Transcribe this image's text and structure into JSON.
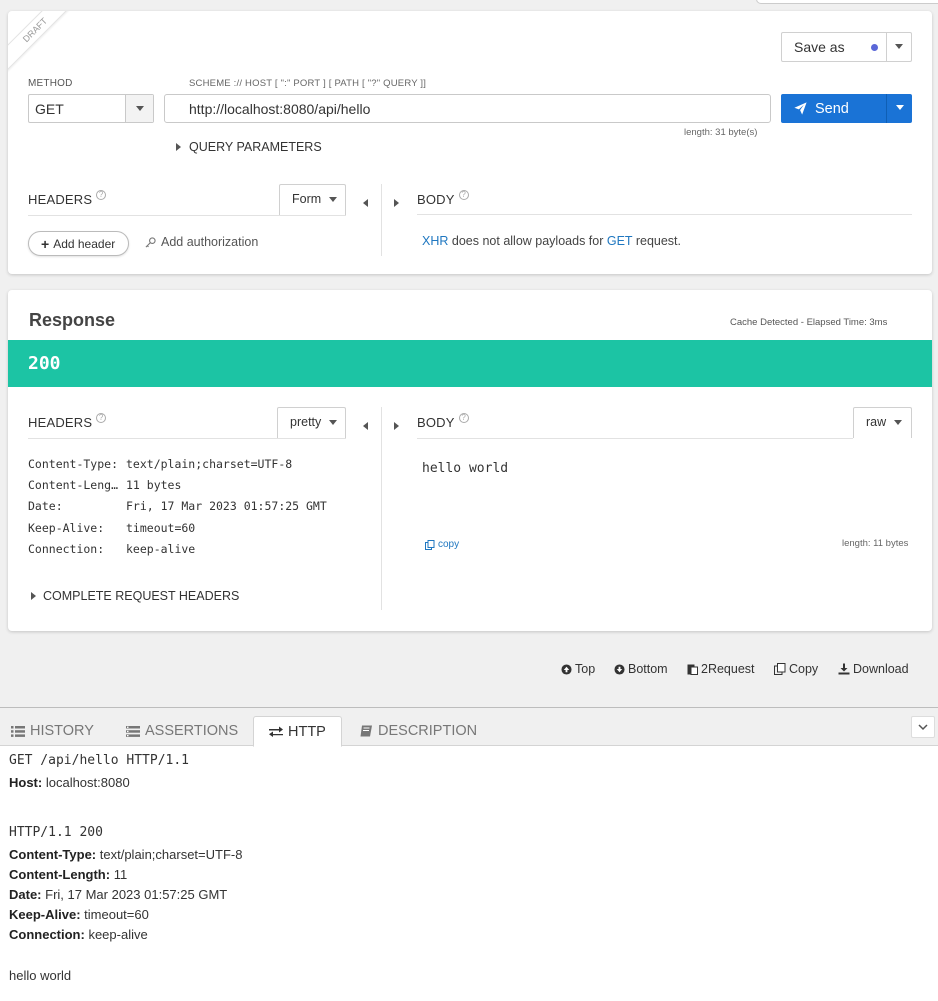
{
  "request": {
    "draft_label": "DRAFT",
    "save_as_label": "Save as",
    "method_label": "METHOD",
    "method_value": "GET",
    "url_hint": "SCHEME :// HOST [ \":\" PORT ] [ PATH [ \"?\" QUERY ]]",
    "url_value": "http://localhost:8080/api/hello",
    "url_length": "length: 31 byte(s)",
    "send_label": "Send",
    "query_params_label": "QUERY PARAMETERS",
    "headers_label": "HEADERS",
    "headers_mode": "Form",
    "add_header_label": "Add header",
    "add_auth_label": "Add authorization",
    "body_label": "BODY",
    "body_note_xhr": "XHR",
    "body_note_mid": "does not allow payloads for",
    "body_note_get": "GET",
    "body_note_end": "request."
  },
  "response": {
    "title": "Response",
    "cache_info": "Cache Detected - Elapsed Time: 3ms",
    "status_code": "200",
    "headers_label": "HEADERS",
    "headers_mode": "pretty",
    "headers": [
      {
        "key": "Content-Type:",
        "value": "text/plain;charset=UTF-8"
      },
      {
        "key": "Content-Length:",
        "value": "11 bytes"
      },
      {
        "key": "Date:",
        "value": "Fri, 17 Mar 2023 01:57:25 GMT"
      },
      {
        "key": "Keep-Alive:",
        "value": "timeout=60"
      },
      {
        "key": "Connection:",
        "value": "keep-alive"
      }
    ],
    "complete_request_headers_label": "COMPLETE REQUEST HEADERS",
    "body_label": "BODY",
    "body_mode": "raw",
    "body_text": "hello world",
    "copy_label": "copy",
    "body_length": "length: 11 bytes"
  },
  "toolbar": {
    "top_label": "Top",
    "bottom_label": "Bottom",
    "to_request_label": "2Request",
    "copy_label": "Copy",
    "download_label": "Download"
  },
  "tabs": [
    {
      "label": "HISTORY"
    },
    {
      "label": "ASSERTIONS"
    },
    {
      "label": "HTTP"
    },
    {
      "label": "DESCRIPTION"
    }
  ],
  "http": {
    "request_line": "GET /api/hello HTTP/1.1",
    "request_headers": [
      {
        "key": "Host:",
        "value": "localhost:8080"
      }
    ],
    "status_line": "HTTP/1.1 200",
    "response_headers": [
      {
        "key": "Content-Type:",
        "value": "text/plain;charset=UTF-8"
      },
      {
        "key": "Content-Length:",
        "value": "11"
      },
      {
        "key": "Date:",
        "value": "Fri, 17 Mar 2023 01:57:25 GMT"
      },
      {
        "key": "Keep-Alive:",
        "value": "timeout=60"
      },
      {
        "key": "Connection:",
        "value": "keep-alive"
      }
    ],
    "body": "hello world"
  },
  "colors": {
    "send_blue": "#1a73d6",
    "status_teal": "#1cc4a4",
    "link_blue": "#1f77c0"
  }
}
